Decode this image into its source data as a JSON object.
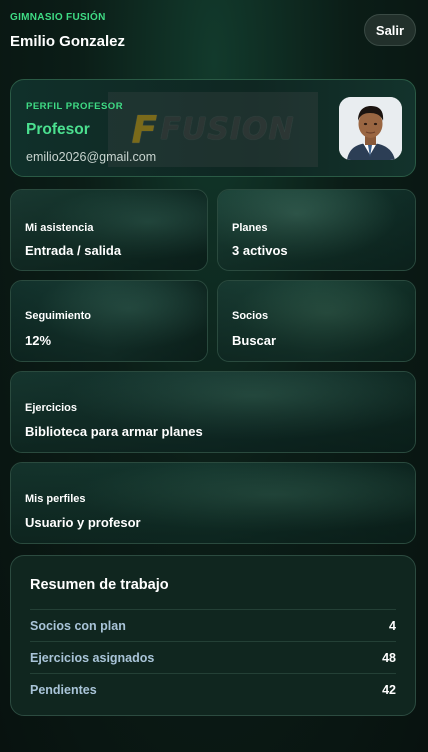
{
  "header": {
    "gym_name": "GIMNASIO FUSIÓN",
    "user_name": "Emilio Gonzalez",
    "logout_label": "Salir"
  },
  "profile": {
    "kicker": "PERFIL PROFESOR",
    "role": "Profesor",
    "email": "emilio2026@gmail.com",
    "logo_text": "FUSION",
    "logo_letter": "F"
  },
  "tiles": [
    {
      "label": "Mi asistencia",
      "value": "Entrada / salida"
    },
    {
      "label": "Planes",
      "value": "3 activos"
    },
    {
      "label": "Seguimiento",
      "value": "12%"
    },
    {
      "label": "Socios",
      "value": "Buscar"
    },
    {
      "label": "Ejercicios",
      "value": "Biblioteca para armar planes"
    },
    {
      "label": "Mis perfiles",
      "value": "Usuario y profesor"
    }
  ],
  "summary": {
    "title": "Resumen de trabajo",
    "rows": [
      {
        "label": "Socios con plan",
        "value": "4"
      },
      {
        "label": "Ejercicios asignados",
        "value": "48"
      },
      {
        "label": "Pendientes",
        "value": "42"
      }
    ]
  },
  "colors": {
    "accent": "#3fdc85",
    "background": "#0b1d17",
    "card_border": "#2a4a3e"
  }
}
